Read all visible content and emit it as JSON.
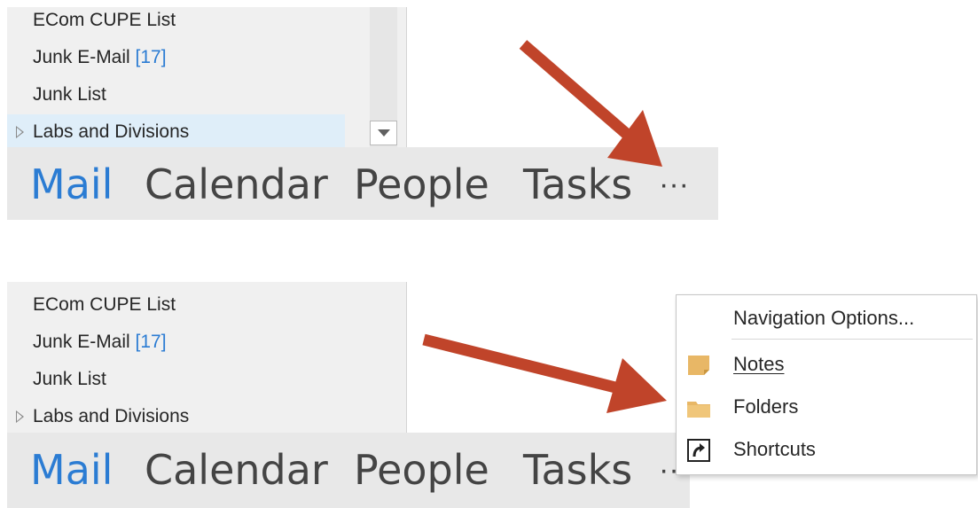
{
  "folders": [
    {
      "name": "ECom CUPE List",
      "count": ""
    },
    {
      "name": "Junk E-Mail",
      "count": "[17]"
    },
    {
      "name": "Junk List",
      "count": ""
    },
    {
      "name": "Labs and Divisions",
      "count": ""
    }
  ],
  "nav": {
    "mail": "Mail",
    "calendar": "Calendar",
    "people": "People",
    "tasks": "Tasks",
    "more": "···"
  },
  "menu": {
    "navigation_options": "Navigation Options...",
    "notes": "Notes",
    "folders": "Folders",
    "shortcuts": "Shortcuts"
  },
  "colors": {
    "accent": "#2b7cd3",
    "arrow": "#c0442a",
    "folder_icon": "#e8b766"
  },
  "icons": {
    "notes": "note-icon",
    "folders": "folder-icon",
    "shortcuts": "shortcut-icon",
    "expander": "triangle-right-icon",
    "scroll": "chevron-down-icon"
  }
}
